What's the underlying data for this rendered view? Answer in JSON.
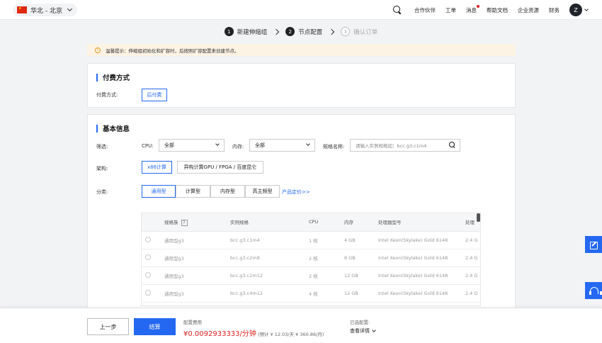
{
  "topbar": {
    "region": "华北 - 北京",
    "nav": [
      "合作伙伴",
      "工单",
      "消息",
      "帮助文档",
      "企业资源",
      "财务"
    ],
    "avatar": "Z"
  },
  "steps": [
    {
      "num": "1",
      "label": "新建伸缩组"
    },
    {
      "num": "2",
      "label": "节点配置"
    },
    {
      "num": "3",
      "label": "确认订单"
    }
  ],
  "tip": {
    "icon": "!",
    "text": "温馨提示：伸缩组初始化和扩容时，后按照扩容配置来创建节点。"
  },
  "payment": {
    "title": "付费方式",
    "label": "付费方式:",
    "option": "后付费"
  },
  "basic": {
    "title": "基本信息",
    "filter_label": "筛选:",
    "cpu_label": "CPU:",
    "cpu_value": "全部",
    "mem_label": "内存:",
    "mem_value": "全部",
    "spec_name_label": "规格名称:",
    "spec_placeholder": "请输入实例规格如：bcc.g3.c1m4",
    "arch_label": "架构:",
    "arch_options": [
      "x86计算",
      "异构计算GPU / FPGA / 百度昆仑"
    ],
    "category_label": "分类:",
    "categories": [
      "通用型",
      "计算型",
      "内存型",
      "高主频型"
    ],
    "pricing_link": "产品定价>>"
  },
  "table": {
    "headers": [
      "规格族",
      "实例规格",
      "CPU",
      "内存",
      "处理器型号",
      "处理"
    ],
    "help_icon": "?",
    "rows": [
      [
        "通用型g3",
        "bcc.g3.c1m4",
        "1  核",
        "4  GB",
        "Intel Xeon(Skylake) Gold 6148",
        "2.4  G"
      ],
      [
        "通用型g3",
        "bcc.g3.c2m8",
        "2  核",
        "8  GB",
        "Intel Xeon(Skylake) Gold 6148",
        "2.4  G"
      ],
      [
        "通用型g3",
        "bcc.g3.c2m12",
        "2  核",
        "12  GB",
        "Intel Xeon(Skylake) Gold 6148",
        "2.4  G"
      ],
      [
        "通用型g3",
        "bcc.g3.c4m12",
        "4  核",
        "12  GB",
        "Intel Xeon(Skylake) Gold 6148",
        "2.4  G"
      ]
    ]
  },
  "bottom": {
    "prev": "上一步",
    "settle": "结算",
    "fee_label": "配置费用",
    "fee_value": "¥0.0092933333/分钟",
    "fee_est": "(预计 ¥ 12.03/天  ¥ 360.86/月)",
    "selected_label": "已选配置:",
    "selected_detail": "查看详情"
  },
  "colors": {
    "primary": "#2468f2",
    "price": "#e02020",
    "tip_bg": "#fcf3e4"
  }
}
